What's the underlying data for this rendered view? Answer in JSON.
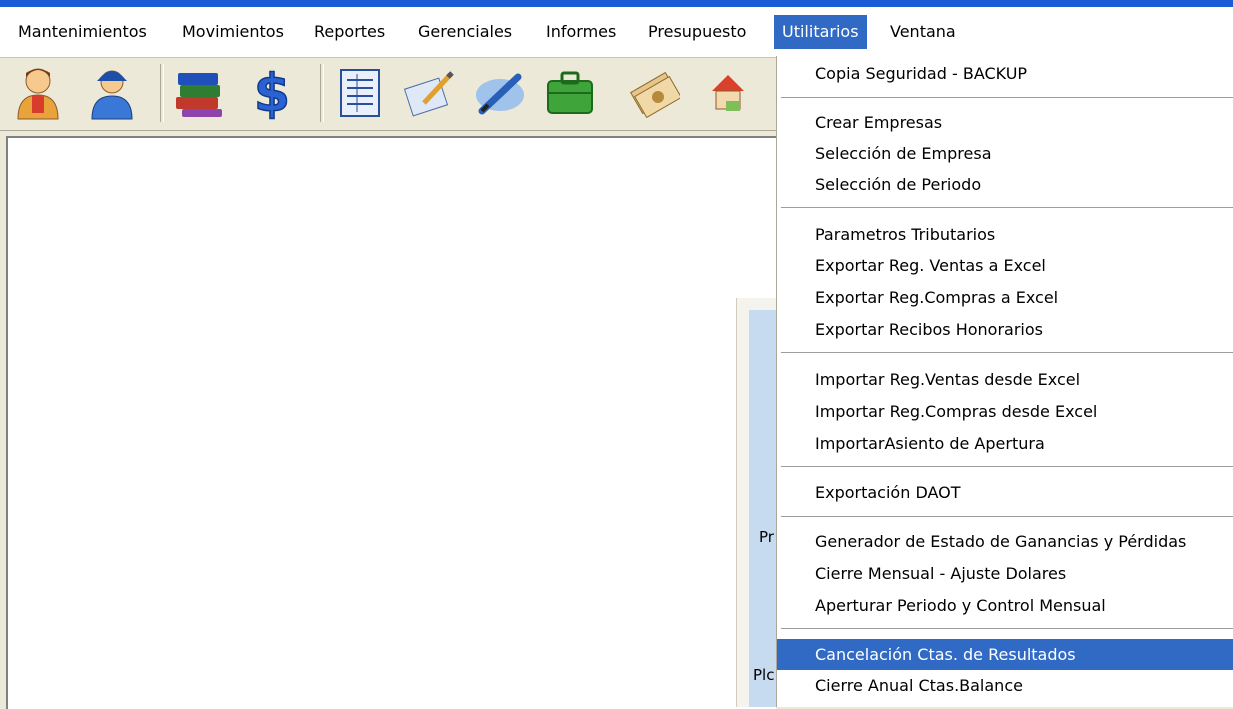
{
  "menubar": {
    "items": [
      {
        "label": "Mantenimientos"
      },
      {
        "label": "Movimientos"
      },
      {
        "label": "Reportes"
      },
      {
        "label": "Gerenciales"
      },
      {
        "label": "Informes"
      },
      {
        "label": "Presupuesto"
      },
      {
        "label": "Utilitarios",
        "active": true
      },
      {
        "label": "Ventana"
      }
    ]
  },
  "toolbar": {
    "buttons": [
      {
        "icon": "user-red-icon"
      },
      {
        "icon": "user-blue-icon"
      },
      {
        "icon": "books-icon"
      },
      {
        "icon": "dollar-icon"
      },
      {
        "icon": "ledger-icon"
      },
      {
        "icon": "edit-document-icon"
      },
      {
        "icon": "pen-icon"
      },
      {
        "icon": "briefcase-icon"
      },
      {
        "icon": "money-icon"
      },
      {
        "icon": "house-money-icon"
      }
    ]
  },
  "panel": {
    "label_1": "Pr",
    "label_2": "Plc"
  },
  "dropdown": {
    "items": [
      {
        "label": "Copia Seguridad - BACKUP"
      },
      {
        "label": "Crear Empresas"
      },
      {
        "label": "Selección de Empresa"
      },
      {
        "label": "Selección de Periodo"
      },
      {
        "label": "Parametros Tributarios"
      },
      {
        "label": "Exportar Reg. Ventas a Excel"
      },
      {
        "label": "Exportar Reg.Compras a Excel"
      },
      {
        "label": "Exportar Recibos Honorarios"
      },
      {
        "label": "Importar Reg.Ventas desde Excel"
      },
      {
        "label": "Importar Reg.Compras desde Excel"
      },
      {
        "label": "ImportarAsiento de  Apertura"
      },
      {
        "label": "Exportación DAOT"
      },
      {
        "label": "Generador de Estado de Ganancias y Pérdidas"
      },
      {
        "label": "Cierre Mensual - Ajuste Dolares"
      },
      {
        "label": "Aperturar Periodo y Control Mensual"
      },
      {
        "label": "Cancelación Ctas. de Resultados",
        "highlighted": true
      },
      {
        "label": "Cierre Anual Ctas.Balance"
      }
    ]
  },
  "colors": {
    "highlight": "#316ac5",
    "title_bar": "#1c5bd6",
    "panel_blue": "#c6dbef"
  }
}
